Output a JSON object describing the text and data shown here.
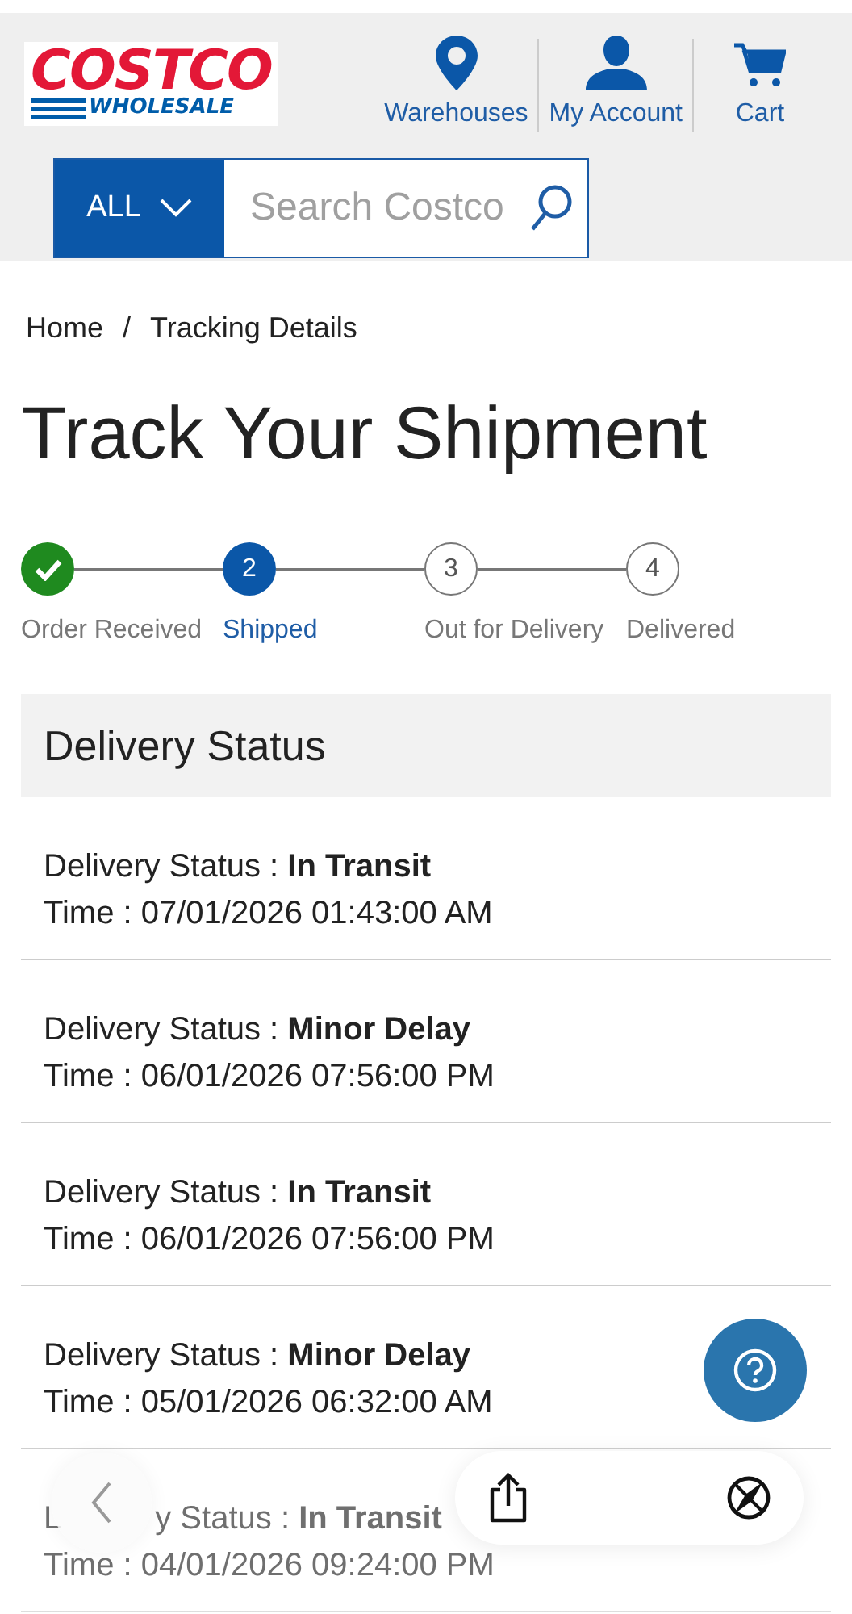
{
  "header": {
    "logo": {
      "top": "COSTCO",
      "bottom": "WHOLESALE"
    },
    "nav": [
      {
        "kind": "pin",
        "label": "Warehouses"
      },
      {
        "kind": "person",
        "label": "My Account"
      },
      {
        "kind": "cart",
        "label": "Cart"
      }
    ],
    "search": {
      "category": "ALL",
      "placeholder": "Search Costco"
    }
  },
  "breadcrumb": [
    "Home",
    "/",
    "Tracking Details"
  ],
  "title": "Track Your Shipment",
  "steps": [
    {
      "label": "Order Received",
      "done": true,
      "selected": false
    },
    {
      "marker": "2",
      "label": "Shipped",
      "done": false,
      "selected": true
    },
    {
      "marker": "3",
      "label": "Out for Delivery",
      "done": false,
      "selected": false
    },
    {
      "marker": "4",
      "label": "Delivered",
      "done": false,
      "selected": false
    }
  ],
  "delivery_status": {
    "heading": "Delivery Status",
    "events": [
      {
        "label": [
          "Delivery Status : "
        ],
        "status": "In Transit",
        "time": "Time : 07/01/2026 01:43:00 AM"
      },
      {
        "label": [
          "Delivery Status : "
        ],
        "status": "Minor Delay",
        "time": "Time : 06/01/2026 07:56:00 PM"
      },
      {
        "label": [
          "Delivery Status : "
        ],
        "status": "In Transit",
        "time": "Time : 06/01/2026 07:56:00 PM"
      },
      {
        "label": [
          "Delivery Status : "
        ],
        "status": "Minor Delay",
        "time": "Time : 05/01/2026 06:32:00 AM"
      },
      {
        "label": [
          "L",
          "y Status : "
        ],
        "status": "In Transit",
        "time": "Time : 04/01/2026 09:24:00 PM"
      }
    ]
  }
}
